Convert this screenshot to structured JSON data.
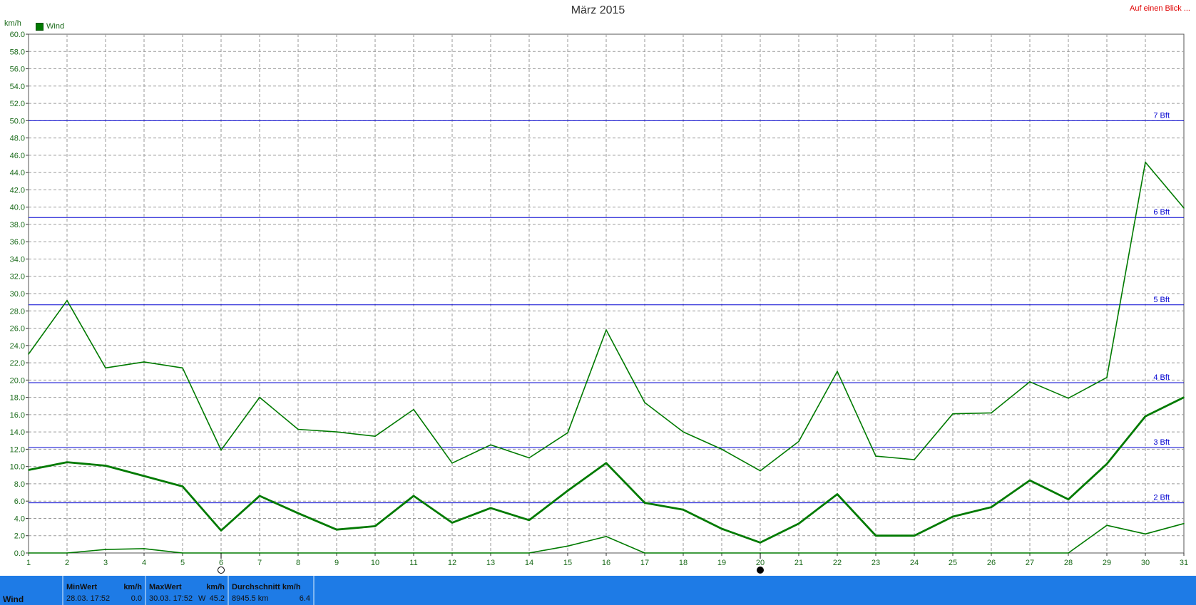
{
  "header": {
    "title": "März 2015",
    "top_right_link": "Auf einen Blick ...",
    "unit": "km/h",
    "legend_label": "Wind"
  },
  "colors": {
    "series": "#007a00",
    "beaufort": "#0000d0",
    "grid": "#9a9a9a",
    "footer_bg": "#1e7be6",
    "link": "#e00000"
  },
  "chart_data": {
    "type": "line",
    "title": "März 2015",
    "ylabel": "km/h",
    "xlabel": "",
    "ylim": [
      0,
      60
    ],
    "y_tick_step": 2,
    "x": [
      1,
      2,
      3,
      4,
      5,
      6,
      7,
      8,
      9,
      10,
      11,
      12,
      13,
      14,
      15,
      16,
      17,
      18,
      19,
      20,
      21,
      22,
      23,
      24,
      25,
      26,
      27,
      28,
      29,
      30,
      31
    ],
    "series": [
      {
        "name": "",
        "role": "max",
        "values": [
          23.0,
          29.2,
          21.4,
          22.1,
          21.4,
          11.9,
          18.0,
          14.3,
          14.0,
          13.5,
          16.6,
          10.4,
          12.5,
          11.0,
          13.9,
          25.8,
          17.4,
          14.0,
          12.0,
          9.5,
          12.9,
          21.0,
          11.2,
          10.8,
          16.1,
          16.2,
          19.8,
          17.9,
          20.3,
          45.2,
          39.9
        ]
      },
      {
        "name": "",
        "role": "avg",
        "values": [
          9.6,
          10.5,
          10.1,
          8.9,
          7.7,
          2.6,
          6.6,
          4.6,
          2.7,
          3.1,
          6.6,
          3.5,
          5.2,
          3.8,
          7.2,
          10.4,
          5.8,
          5.0,
          2.8,
          1.2,
          3.4,
          6.8,
          2.0,
          2.0,
          4.2,
          5.3,
          8.4,
          6.2,
          10.3,
          15.8,
          18.0
        ]
      },
      {
        "name": "",
        "role": "min",
        "values": [
          0.0,
          0.0,
          0.4,
          0.5,
          0.0,
          0.0,
          0.0,
          0.0,
          0.0,
          0.0,
          0.0,
          0.0,
          0.0,
          0.0,
          0.8,
          1.9,
          0.0,
          0.0,
          0.0,
          0.0,
          0.0,
          0.0,
          0.0,
          0.0,
          0.0,
          0.0,
          0.0,
          0.0,
          3.2,
          2.2,
          3.4
        ]
      }
    ],
    "beaufort_lines": [
      {
        "label": "2 Bft",
        "value": 5.8
      },
      {
        "label": "3 Bft",
        "value": 12.2
      },
      {
        "label": "4 Bft",
        "value": 19.7
      },
      {
        "label": "5 Bft",
        "value": 28.7
      },
      {
        "label": "6 Bft",
        "value": 38.8
      },
      {
        "label": "7 Bft",
        "value": 50.0
      }
    ],
    "moon_markers": [
      {
        "day": 6,
        "phase": "full"
      },
      {
        "day": 20,
        "phase": "new"
      }
    ],
    "grid": true,
    "legend_position": "top-left"
  },
  "footer": {
    "row_label": "Wind",
    "min": {
      "head_left": "MinWert",
      "head_right": "km/h",
      "when": "28.03.  17:52",
      "value": "0.0"
    },
    "max": {
      "head_left": "MaxWert",
      "head_right": "km/h",
      "when": "30.03.  17:52",
      "dir": "W",
      "value": "45.2"
    },
    "avg": {
      "head_left": "Durchschnitt km/h",
      "distance": "8945.5 km",
      "value": "6.4"
    }
  }
}
